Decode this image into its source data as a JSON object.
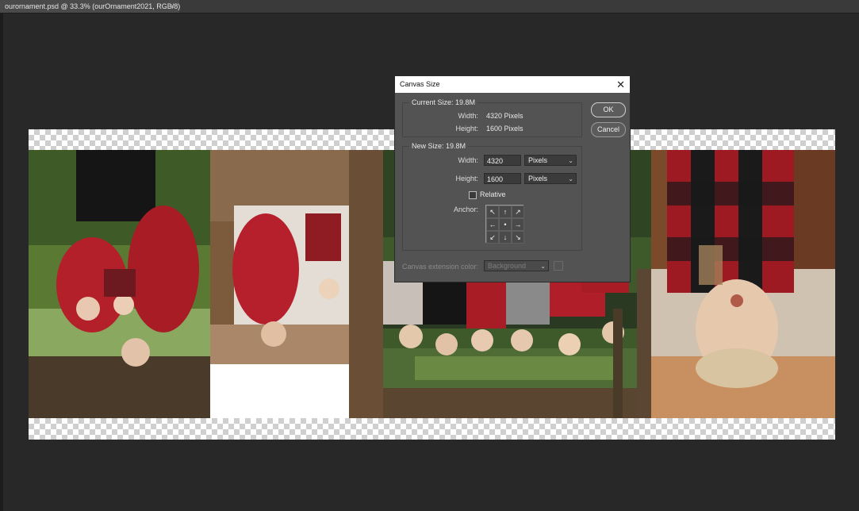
{
  "tab": {
    "title": "ourornament.psd @ 33.3% (ourOrnament2021, RGB/8)",
    "close": "×"
  },
  "dialog": {
    "title": "Canvas Size",
    "close": "✕",
    "current": {
      "legend": "Current Size: 19.8M",
      "width_label": "Width:",
      "width_value": "4320 Pixels",
      "height_label": "Height:",
      "height_value": "1600 Pixels"
    },
    "new": {
      "legend": "New Size: 19.8M",
      "width_label": "Width:",
      "width_value": "4320",
      "width_unit": "Pixels",
      "height_label": "Height:",
      "height_value": "1600",
      "height_unit": "Pixels",
      "relative_label": "Relative",
      "relative_checked": false,
      "anchor_label": "Anchor:"
    },
    "anchor_arrows": [
      "↖",
      "↑",
      "↗",
      "←",
      "•",
      "→",
      "↙",
      "↓",
      "↘"
    ],
    "extension_label": "Canvas extension color:",
    "extension_value": "Background",
    "ok_label": "OK",
    "cancel_label": "Cancel"
  }
}
